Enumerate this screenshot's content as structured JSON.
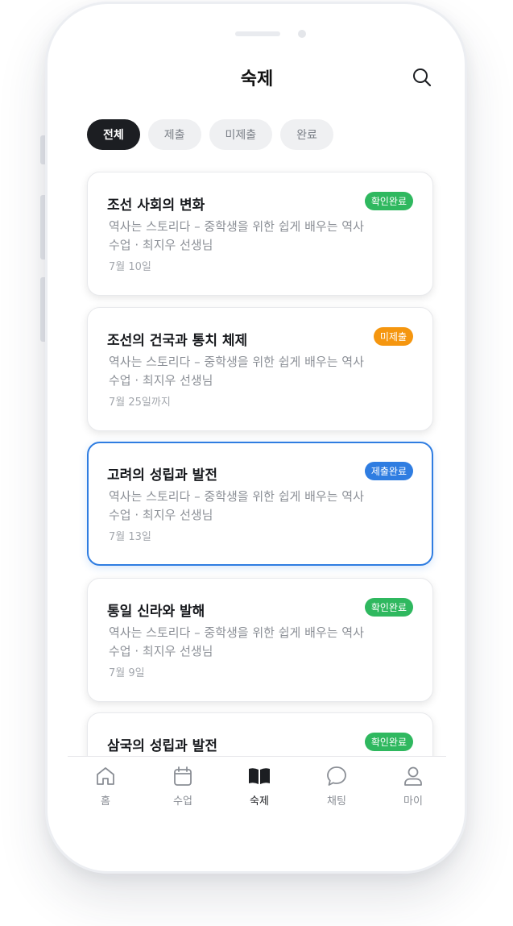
{
  "header": {
    "title": "숙제"
  },
  "filters": [
    {
      "label": "전체",
      "active": true
    },
    {
      "label": "제출",
      "active": false
    },
    {
      "label": "미제출",
      "active": false
    },
    {
      "label": "완료",
      "active": false
    }
  ],
  "assignments": [
    {
      "title": "조선 사회의 변화",
      "desc": "역사는 스토리다 – 중학생을 위한 쉽게 배우는 역사 수업 · 최지우 선생님",
      "date": "7월 10일",
      "badge": "확인완료",
      "badge_color": "#2fb85f"
    },
    {
      "title": "조선의 건국과 통치 체제",
      "desc": "역사는 스토리다 – 중학생을 위한 쉽게 배우는 역사 수업 · 최지우 선생님",
      "date": "7월 25일까지",
      "badge": "미제출",
      "badge_color": "#f5960f"
    },
    {
      "title": "고려의 성립과 발전",
      "desc": "역사는 스토리다 – 중학생을 위한 쉽게 배우는 역사 수업 · 최지우 선생님",
      "date": "7월 13일",
      "badge": "제출완료",
      "badge_color": "#2f7de1",
      "selected": true
    },
    {
      "title": "통일 신라와 발해",
      "desc": "역사는 스토리다 – 중학생을 위한 쉽게 배우는 역사 수업 · 최지우 선생님",
      "date": "7월 9일",
      "badge": "확인완료",
      "badge_color": "#2fb85f"
    },
    {
      "title": "삼국의 성립과 발전",
      "badge": "확인완료",
      "badge_color": "#2fb85f"
    }
  ],
  "tabbar": [
    {
      "label": "홈",
      "icon": "home-icon"
    },
    {
      "label": "수업",
      "icon": "calendar-icon"
    },
    {
      "label": "숙제",
      "icon": "book-icon",
      "active": true
    },
    {
      "label": "채팅",
      "icon": "chat-bubble-icon"
    },
    {
      "label": "마이",
      "icon": "user-icon"
    }
  ]
}
